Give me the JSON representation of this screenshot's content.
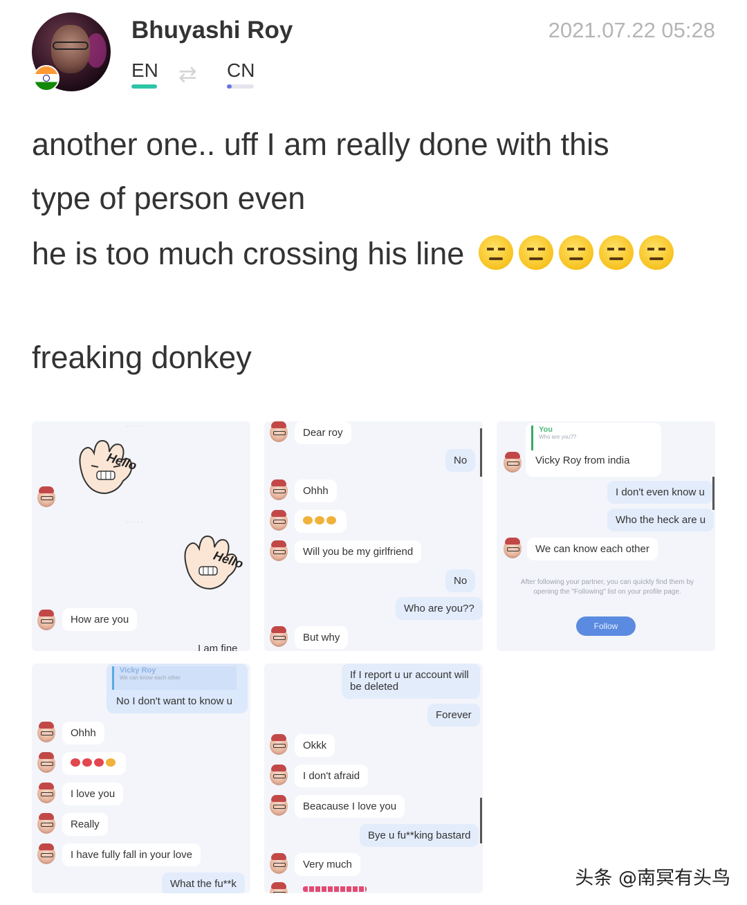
{
  "header": {
    "author_name": "Bhuyashi Roy",
    "timestamp": "2021.07.22 05:28",
    "lang_source": "EN",
    "lang_target": "CN",
    "swap_icon": "swap-arrows-icon",
    "flag_icon": "india-flag-icon"
  },
  "post": {
    "line1": "another one.. uff I am really done with this",
    "line2": "type of person even",
    "line3": "he is too much crossing his line",
    "line4": "freaking donkey",
    "emoji": "expressionless-face-emoji",
    "emoji_count": 5
  },
  "screenshots": {
    "s1": {
      "sticker_text_1": "Hello",
      "sticker_text_2": "Hello",
      "msg1": "How are you",
      "msg2": "I am fine"
    },
    "s2": {
      "msg1": "Dear roy",
      "msg2": "No",
      "msg3": "Ohhh",
      "msg4": "Will you be my girlfriend",
      "msg5": "No",
      "msg6": "Who are you??",
      "msg7": "But why"
    },
    "s3": {
      "quote_name": "You",
      "quote_text": "Who are you??",
      "msg1": "Vicky Roy from india",
      "msg2": "I don't even know u",
      "msg3": "Who the heck are u",
      "msg4": "We can know each other",
      "follow_hint": "After following your partner, you can quickly find them by opening the \"Following\" list on your profile page.",
      "follow_button": "Follow"
    },
    "s4": {
      "quote_name": "Vicky Roy",
      "quote_text": "We can know each other",
      "msg1": "No I don't want to know u",
      "msg2": "Ohhh",
      "msg3": "I love you",
      "msg4": "Really",
      "msg5": "I have fully fall in your love",
      "msg6": "What the fu**k"
    },
    "s5": {
      "msg1": "If I report u ur account will be deleted",
      "msg2": "Forever",
      "msg3": "Okkk",
      "msg4": "I don't afraid",
      "msg5": "Beacause I love you",
      "msg6": "Bye u fu**king bastard",
      "msg7": "Very much"
    }
  },
  "watermark": "头条 @南冥有头鸟",
  "colors": {
    "accent_en": "#2fc4a7",
    "accent_cn": "#6b74e8",
    "follow_button": "#5b8be0"
  }
}
